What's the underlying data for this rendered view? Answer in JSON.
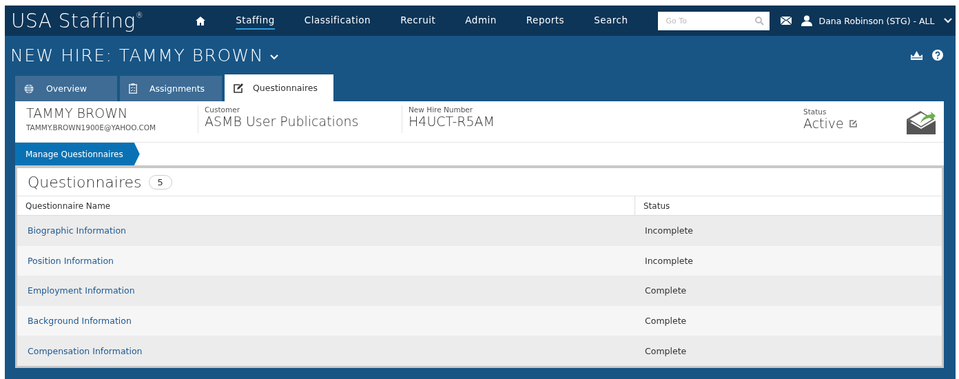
{
  "nav": {
    "logo": "USA Staffing",
    "logo_mark": "®",
    "items": [
      {
        "label": "Staffing",
        "selected": true
      },
      {
        "label": "Classification",
        "selected": false
      },
      {
        "label": "Recruit",
        "selected": false
      },
      {
        "label": "Admin",
        "selected": false
      },
      {
        "label": "Reports",
        "selected": false
      },
      {
        "label": "Search",
        "selected": false
      }
    ],
    "goto": {
      "placeholder": "Go To"
    },
    "user": "Dana Robinson (STG) - ALL"
  },
  "page_title": "NEW HIRE: TAMMY BROWN",
  "tabs": [
    {
      "label": "Overview",
      "kind": "globe",
      "selected": false
    },
    {
      "label": "Assignments",
      "kind": "clipboard",
      "selected": false
    },
    {
      "label": "Questionnaires",
      "kind": "edit",
      "selected": true
    }
  ],
  "hire": {
    "name": "TAMMY BROWN",
    "email": "TAMMY.BROWN1900E@YAHOO.COM",
    "fields": [
      {
        "label": "Customer",
        "value": "ASMB User Publications"
      },
      {
        "label": "New Hire Number",
        "value": "H4UCT-R5AM"
      }
    ],
    "status_label": "Status",
    "status": "Active"
  },
  "breadcrumb": "Manage Questionnaires",
  "questionnaires": {
    "title": "Questionnaires",
    "count": "5",
    "columns": [
      "Questionnaire Name",
      "Status"
    ],
    "rows": [
      {
        "name": "Biographic Information",
        "status": "Incomplete"
      },
      {
        "name": "Position Information",
        "status": "Incomplete"
      },
      {
        "name": "Employment Information",
        "status": "Complete"
      },
      {
        "name": "Background Information",
        "status": "Complete"
      },
      {
        "name": "Compensation Information",
        "status": "Complete"
      }
    ]
  }
}
